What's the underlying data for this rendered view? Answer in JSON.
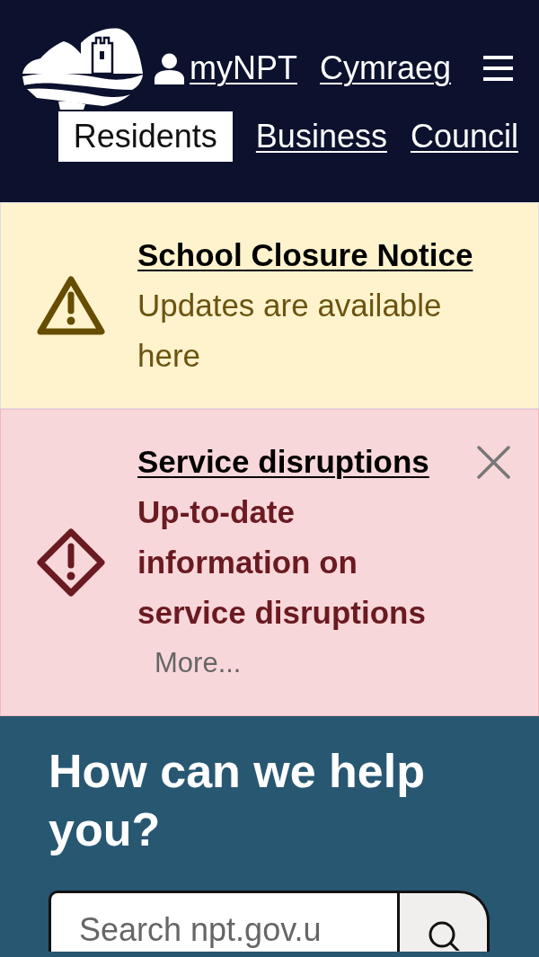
{
  "header": {
    "account_link": "myNPT",
    "language_link": "Cymraeg"
  },
  "nav_tabs": [
    {
      "label": "Residents",
      "selected": true
    },
    {
      "label": "Business",
      "selected": false
    },
    {
      "label": "Council",
      "selected": false
    }
  ],
  "alerts": [
    {
      "kind": "warning",
      "title": "School Closure Notice",
      "text": "Updates are available here",
      "dismissible": false
    },
    {
      "kind": "danger",
      "title": "Service disruptions",
      "text": "Up-to-date information on service disruptions",
      "more": "More...",
      "dismissible": true
    }
  ],
  "help": {
    "heading": "How can we help you?",
    "search": {
      "placeholder": "Search npt.gov.u"
    }
  }
}
